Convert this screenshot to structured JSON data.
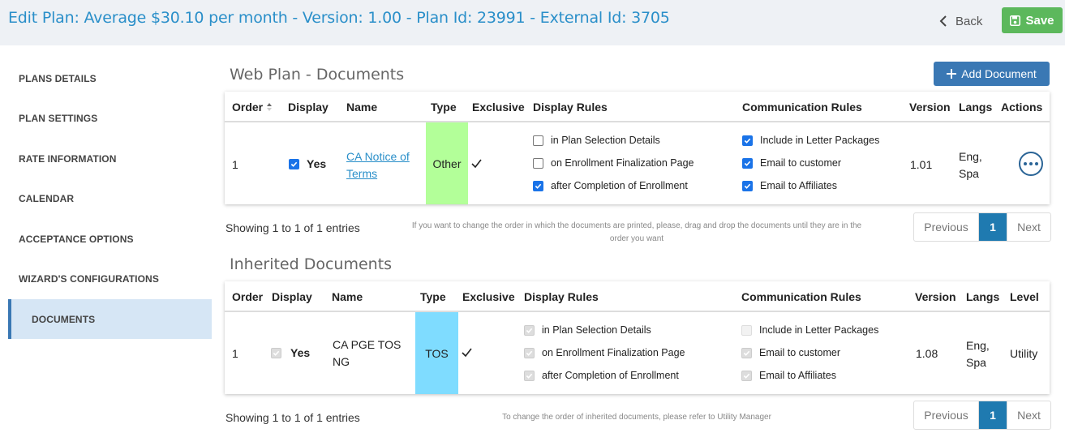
{
  "header": {
    "title": "Edit Plan: Average $30.10 per month - Version: 1.00 - Plan Id: 23991 - External Id: 3705",
    "back_label": "Back",
    "save_label": "Save"
  },
  "sidebar": {
    "items": [
      {
        "label": "PLANS DETAILS"
      },
      {
        "label": "PLAN SETTINGS"
      },
      {
        "label": "RATE INFORMATION"
      },
      {
        "label": "CALENDAR"
      },
      {
        "label": "ACCEPTANCE OPTIONS"
      },
      {
        "label": "WIZARD'S CONFIGURATIONS"
      },
      {
        "label": "DOCUMENTS",
        "active": true
      }
    ]
  },
  "web_docs": {
    "title": "Web Plan - Documents",
    "add_label": "Add Document",
    "headers": {
      "order": "Order",
      "display": "Display",
      "name": "Name",
      "type": "Type",
      "exclusive": "Exclusive",
      "display_rules": "Display Rules",
      "comm_rules": "Communication Rules",
      "version": "Version",
      "langs": "Langs",
      "actions": "Actions"
    },
    "row": {
      "order": "1",
      "display": "Yes",
      "name_line1": "CA Notice of",
      "name_line2": "Terms",
      "type": "Other",
      "type_color": "#b3ff99",
      "display_rules": [
        {
          "label": "in Plan Selection Details",
          "checked": false
        },
        {
          "label": "on Enrollment Finalization Page",
          "checked": false
        },
        {
          "label": "after Completion of Enrollment",
          "checked": true
        }
      ],
      "comm_rules": [
        {
          "label": "Include in Letter Packages",
          "checked": true
        },
        {
          "label": "Email to customer",
          "checked": true
        },
        {
          "label": "Email to Affiliates",
          "checked": true
        }
      ],
      "version": "1.01",
      "langs_line1": "Eng,",
      "langs_line2": "Spa"
    },
    "entries": "Showing 1 to 1 of 1 entries",
    "hint_line1": "If you want to change the order in which the documents are printed, please, drag and drop the documents until they are in the",
    "hint_line2": "order you want",
    "pager": {
      "prev": "Previous",
      "current": "1",
      "next": "Next"
    }
  },
  "inherited_docs": {
    "title": "Inherited Documents",
    "headers": {
      "order": "Order",
      "display": "Display",
      "name": "Name",
      "type": "Type",
      "exclusive": "Exclusive",
      "display_rules": "Display Rules",
      "comm_rules": "Communication Rules",
      "version": "Version",
      "langs": "Langs",
      "level": "Level"
    },
    "row": {
      "order": "1",
      "display": "Yes",
      "name_line1": "CA PGE TOS",
      "name_line2": "NG",
      "type": "TOS",
      "type_color": "#7fdcff",
      "display_rules": [
        {
          "label": "in Plan Selection Details",
          "checked": true
        },
        {
          "label": "on Enrollment Finalization Page",
          "checked": true
        },
        {
          "label": "after Completion of Enrollment",
          "checked": true
        }
      ],
      "comm_rules": [
        {
          "label": "Include in Letter Packages",
          "checked": false
        },
        {
          "label": "Email to customer",
          "checked": true
        },
        {
          "label": "Email to Affiliates",
          "checked": true
        }
      ],
      "version": "1.08",
      "langs_line1": "Eng,",
      "langs_line2": "Spa",
      "level": "Utility"
    },
    "entries": "Showing 1 to 1 of 1 entries",
    "hint": "To change the order of inherited documents, please refer to Utility Manager",
    "pager": {
      "prev": "Previous",
      "current": "1",
      "next": "Next"
    }
  },
  "colors": {
    "accent": "#2a8fc9",
    "save": "#5cb85c",
    "primary": "#3a78b4",
    "checkbox": "#1a73e8"
  }
}
